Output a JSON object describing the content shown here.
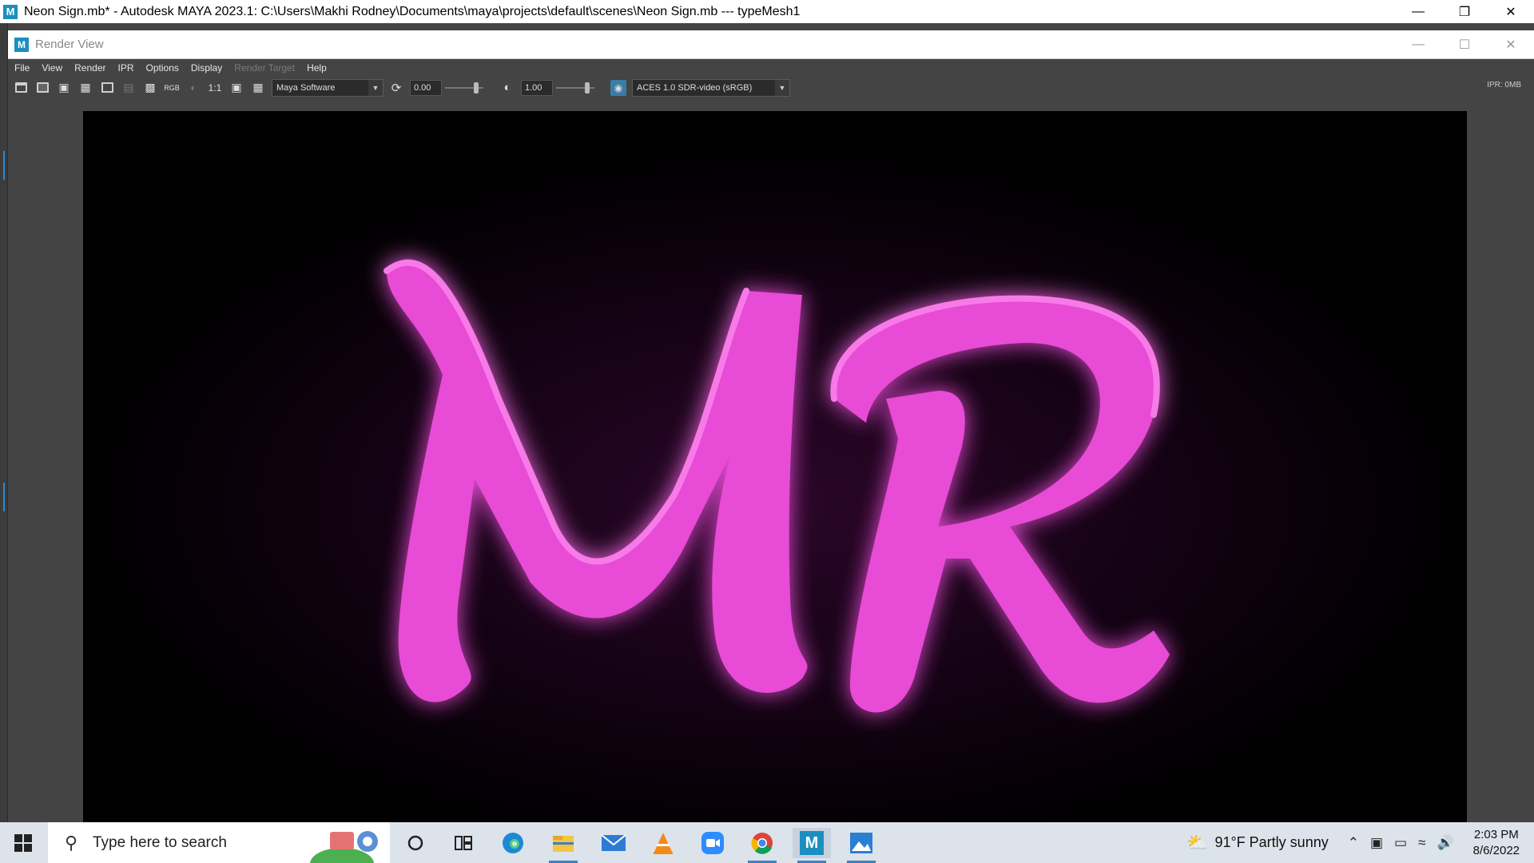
{
  "app": {
    "title": "Neon Sign.mb* - Autodesk MAYA 2023.1: C:\\Users\\Makhi Rodney\\Documents\\maya\\projects\\default\\scenes\\Neon Sign.mb   ---   typeMesh1",
    "icon_letter": "M"
  },
  "render_view": {
    "title": "Render View",
    "menu": [
      "File",
      "View",
      "Render",
      "IPR",
      "Options",
      "Display",
      "Render Target",
      "Help"
    ],
    "menu_disabled": "Render Target",
    "toolbar": {
      "rgb_label": "RGB",
      "ratio_label": "1:1",
      "renderer": "Maya Software",
      "exposure": "0.00",
      "gamma": "1.00",
      "view_transform": "ACES 1.0 SDR-video (sRGB)",
      "ipr_memory": "IPR: 0MB"
    },
    "render_text": "MR",
    "neon_color": "#ee4ed8",
    "glow_color": "#b01aa8"
  },
  "taskbar": {
    "search_placeholder": "Type here to search",
    "weather": "91°F  Partly sunny",
    "time": "2:03 PM",
    "date": "8/6/2022",
    "maya_icon_letter": "M"
  }
}
